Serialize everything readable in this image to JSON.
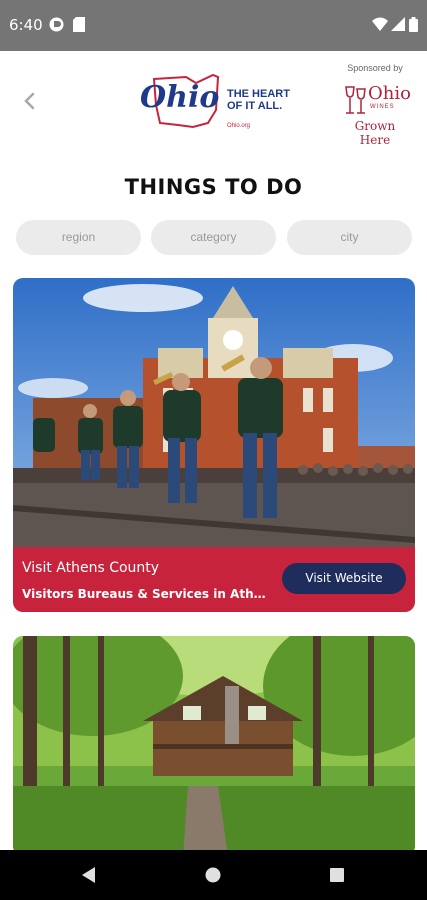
{
  "status_bar": {
    "time": "6:40"
  },
  "header": {
    "back_icon": "chevron-left-icon",
    "logo": {
      "wordmark": "Ohio",
      "tagline_line1": "THE HEART",
      "tagline_line2": "OF IT ALL.",
      "url": "Ohio.org"
    },
    "sponsor": {
      "label": "Sponsored by",
      "brand": "Ohio",
      "brand_sub": "WINES",
      "tagline": "Grown Here"
    }
  },
  "page": {
    "title": "THINGS TO DO"
  },
  "filters": [
    {
      "placeholder": "region"
    },
    {
      "placeholder": "category"
    },
    {
      "placeholder": "city"
    }
  ],
  "cards": [
    {
      "title": "Visit Athens County",
      "subtitle": "Visitors Bureaus & Services in Athens, Athens County",
      "button_label": "Visit Website"
    }
  ],
  "colors": {
    "accent_red": "#c8233c",
    "button_navy": "#1f2d5c",
    "status_bar": "#757575"
  }
}
